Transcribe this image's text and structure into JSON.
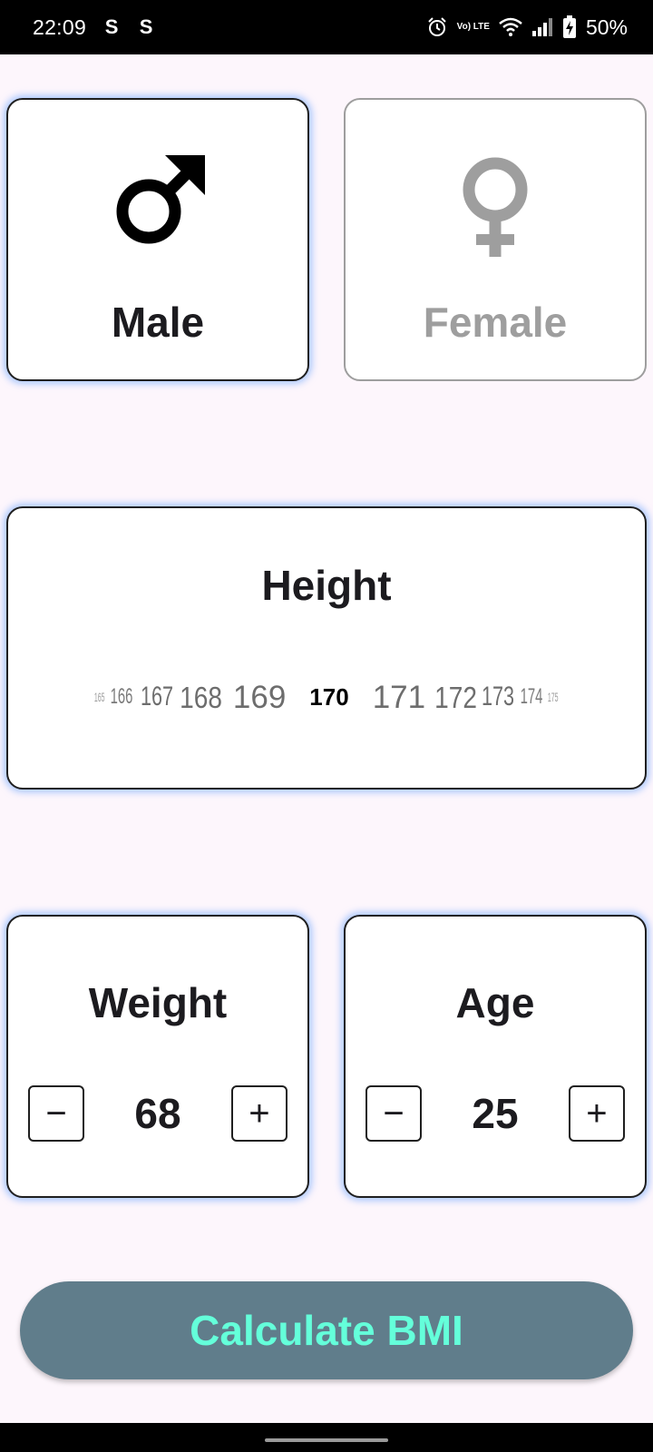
{
  "status_bar": {
    "time": "22:09",
    "left_icons": [
      "S",
      "S"
    ],
    "volte_label": "Vo) LTE",
    "battery": "50%",
    "icons": [
      "alarm-icon",
      "volte-icon",
      "wifi-icon",
      "signal-icon",
      "battery-charging-icon"
    ]
  },
  "gender": {
    "male_label": "Male",
    "female_label": "Female",
    "selected": "male",
    "male_icon": "male-symbol-icon",
    "female_icon": "female-symbol-icon"
  },
  "height": {
    "title": "Height",
    "values": [
      "165",
      "166",
      "167",
      "168",
      "169",
      "170",
      "171",
      "172",
      "173",
      "174",
      "175"
    ],
    "selected": "170"
  },
  "weight": {
    "title": "Weight",
    "value": "68",
    "minus_label": "−",
    "plus_label": "+"
  },
  "age": {
    "title": "Age",
    "value": "25",
    "minus_label": "−",
    "plus_label": "+"
  },
  "calculate_button": {
    "label": "Calculate BMI"
  },
  "colors": {
    "background": "#fdf6fc",
    "card_border_active": "#1f1f1f",
    "card_border_inactive": "#9e9e9e",
    "glow": "#64a0ff",
    "button_bg": "#607d8b",
    "button_text": "#64ffda",
    "inactive_text": "#9e9e9e"
  }
}
